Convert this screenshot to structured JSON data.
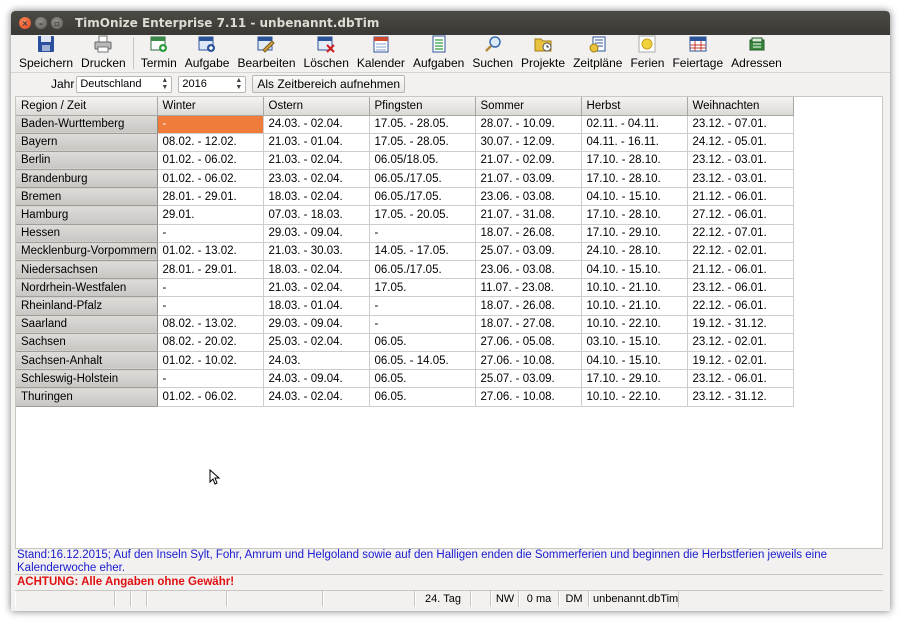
{
  "window": {
    "title": "TimOnize Enterprise 7.11 - unbenannt.dbTim"
  },
  "toolbar": [
    {
      "label": "Speichern",
      "icon": "save-icon"
    },
    {
      "label": "Drucken",
      "icon": "printer-icon"
    },
    {
      "label": "Termin",
      "icon": "appointment-icon"
    },
    {
      "label": "Aufgabe",
      "icon": "task-icon"
    },
    {
      "label": "Bearbeiten",
      "icon": "edit-icon"
    },
    {
      "label": "Löschen",
      "icon": "delete-icon"
    },
    {
      "label": "Kalender",
      "icon": "calendar-icon"
    },
    {
      "label": "Aufgaben",
      "icon": "tasks-icon"
    },
    {
      "label": "Suchen",
      "icon": "search-icon"
    },
    {
      "label": "Projekte",
      "icon": "projects-icon"
    },
    {
      "label": "Zeitpläne",
      "icon": "schedules-icon"
    },
    {
      "label": "Ferien",
      "icon": "holidays-icon"
    },
    {
      "label": "Feiertage",
      "icon": "public-holidays-icon"
    },
    {
      "label": "Adressen",
      "icon": "addresses-icon"
    }
  ],
  "filter": {
    "year_label": "Jahr",
    "country": "Deutschland",
    "year": "2016",
    "record_button": "Als Zeitbereich aufnehmen"
  },
  "grid": {
    "columns": [
      "Region / Zeit",
      "Winter",
      "Ostern",
      "Pfingsten",
      "Sommer",
      "Herbst",
      "Weihnachten"
    ],
    "rows": [
      [
        "Baden-Wurttemberg",
        "-",
        "24.03. - 02.04.",
        "17.05. - 28.05.",
        "28.07. - 10.09.",
        "02.11. - 04.11.",
        "23.12. - 07.01."
      ],
      [
        "Bayern",
        "08.02. - 12.02.",
        "21.03. - 01.04.",
        "17.05. - 28.05.",
        "30.07. - 12.09.",
        "04.11. - 16.11.",
        "24.12. - 05.01."
      ],
      [
        "Berlin",
        "01.02. - 06.02.",
        "21.03. - 02.04.",
        "06.05/18.05.",
        "21.07. - 02.09.",
        "17.10. - 28.10.",
        "23.12. - 03.01."
      ],
      [
        "Brandenburg",
        "01.02. - 06.02.",
        "23.03. - 02.04.",
        "06.05./17.05.",
        "21.07. - 03.09.",
        "17.10. - 28.10.",
        "23.12. - 03.01."
      ],
      [
        "Bremen",
        "28.01. - 29.01.",
        "18.03. - 02.04.",
        "06.05./17.05.",
        "23.06. - 03.08.",
        "04.10. - 15.10.",
        "21.12. - 06.01."
      ],
      [
        "Hamburg",
        "29.01.",
        "07.03. - 18.03.",
        "17.05. - 20.05.",
        "21.07. - 31.08.",
        "17.10. - 28.10.",
        "27.12. - 06.01."
      ],
      [
        "Hessen",
        "-",
        "29.03. - 09.04.",
        "-",
        "18.07. - 26.08.",
        "17.10. - 29.10.",
        "22.12. - 07.01."
      ],
      [
        "Mecklenburg-Vorpommern",
        "01.02. - 13.02.",
        "21.03. - 30.03.",
        "14.05. - 17.05.",
        "25.07. - 03.09.",
        "24.10. - 28.10.",
        "22.12. - 02.01."
      ],
      [
        "Niedersachsen",
        "28.01. - 29.01.",
        "18.03. - 02.04.",
        "06.05./17.05.",
        "23.06. - 03.08.",
        "04.10. - 15.10.",
        "21.12. - 06.01."
      ],
      [
        "Nordrhein-Westfalen",
        "-",
        "21.03. - 02.04.",
        "17.05.",
        "11.07. - 23.08.",
        "10.10. - 21.10.",
        "23.12. - 06.01."
      ],
      [
        "Rheinland-Pfalz",
        "-",
        "18.03. - 01.04.",
        "-",
        "18.07. - 26.08.",
        "10.10. - 21.10.",
        "22.12. - 06.01."
      ],
      [
        "Saarland",
        "08.02. - 13.02.",
        "29.03. - 09.04.",
        "-",
        "18.07. - 27.08.",
        "10.10. - 22.10.",
        "19.12. - 31.12."
      ],
      [
        "Sachsen",
        "08.02. - 20.02.",
        "25.03. - 02.04.",
        "06.05.",
        "27.06. - 05.08.",
        "03.10. - 15.10.",
        "23.12. - 02.01."
      ],
      [
        "Sachsen-Anhalt",
        "01.02. - 10.02.",
        "24.03.",
        "06.05. - 14.05.",
        "27.06. - 10.08.",
        "04.10. - 15.10.",
        "19.12. - 02.01."
      ],
      [
        "Schleswig-Holstein",
        "-",
        "24.03. - 09.04.",
        "06.05.",
        "25.07. - 03.09.",
        "17.10. - 29.10.",
        "23.12. - 06.01."
      ],
      [
        "Thuringen",
        "01.02. - 06.02.",
        "24.03. - 02.04.",
        "06.05.",
        "27.06. - 10.08.",
        "10.10. - 22.10.",
        "23.12. - 31.12."
      ]
    ]
  },
  "info_text": "Stand:16.12.2015; Auf den Inseln Sylt, Fohr, Amrum und Helgoland sowie auf den Halligen enden die Sommerferien und beginnen die Herbstferien jeweils eine Kalenderwoche eher.",
  "warning_text": "ACHTUNG: Alle Angaben ohne Gewähr!",
  "statusbar": {
    "day": "24. Tag",
    "nw": "NW",
    "ma": "0 ma",
    "dm": "DM",
    "file": "unbenannt.dbTim"
  },
  "colors": {
    "highlight_cell": "#f07c3c",
    "info_text": "#1a1ad0",
    "warning_text": "#e01010"
  }
}
